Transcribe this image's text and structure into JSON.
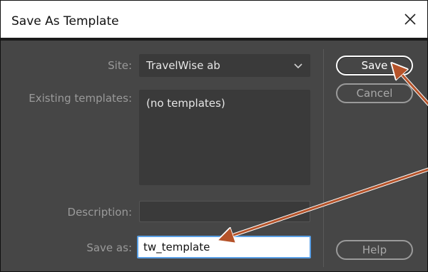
{
  "dialog": {
    "title": "Save As Template"
  },
  "form": {
    "site_label": "Site:",
    "site_value": "TravelWise ab",
    "existing_label": "Existing templates:",
    "existing_items": [
      "(no templates)"
    ],
    "description_label": "Description:",
    "description_value": "",
    "saveas_label": "Save as:",
    "saveas_value": "tw_template"
  },
  "buttons": {
    "save": "Save",
    "cancel": "Cancel",
    "help": "Help"
  },
  "icons": {
    "close": "close-icon",
    "dropdown": "chevron-down-icon"
  },
  "colors": {
    "dialog_bg": "#464646",
    "field_bg": "#3a3a3a",
    "annotation_arrow": "#b5532a",
    "focus_border": "#5aa0e6"
  }
}
